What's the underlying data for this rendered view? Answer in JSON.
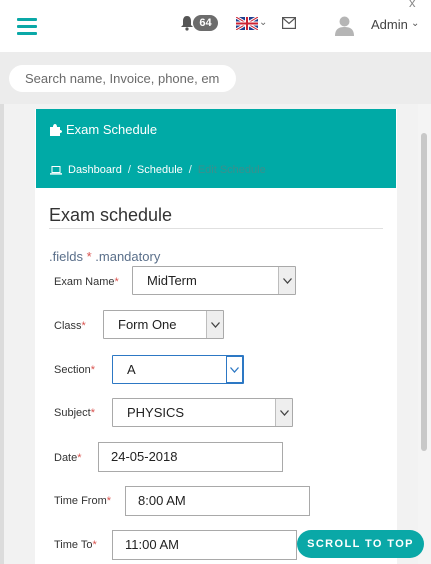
{
  "topbar": {
    "notification_count": "64",
    "user_name": "Admin",
    "close_glyph": "x"
  },
  "search": {
    "placeholder": "Search name, Invoice, phone, email"
  },
  "panel": {
    "header_title": "Exam Schedule",
    "breadcrumbs": [
      "Dashboard",
      "Schedule",
      "Edit Schedule"
    ],
    "form_title": "Exam schedule",
    "mandatory_prefix": ".fields",
    "mandatory_star": "*",
    "mandatory_suffix": ".mandatory"
  },
  "form": {
    "exam_name": {
      "label": "Exam Name",
      "value": "MidTerm"
    },
    "class": {
      "label": "Class",
      "value": "Form One"
    },
    "section": {
      "label": "Section",
      "value": "A"
    },
    "subject": {
      "label": "Subject",
      "value": "PHYSICS"
    },
    "date": {
      "label": "Date",
      "value": "24-05-2018"
    },
    "time_from": {
      "label": "Time From",
      "value": "8:00 AM"
    },
    "time_to": {
      "label": "Time To",
      "value": "11:00 AM"
    },
    "required_star": "*"
  },
  "footer": {
    "scroll_top_label": "SCROLL TO TOP"
  },
  "colors": {
    "accent": "#00aaa6",
    "required": "#d9534f",
    "badge": "#6c6c6c"
  },
  "icons": [
    "hamburger-icon",
    "bell-icon",
    "uk-flag-icon",
    "mail-icon",
    "user-avatar-icon",
    "puzzle-icon",
    "laptop-icon",
    "chevron-down-icon"
  ]
}
